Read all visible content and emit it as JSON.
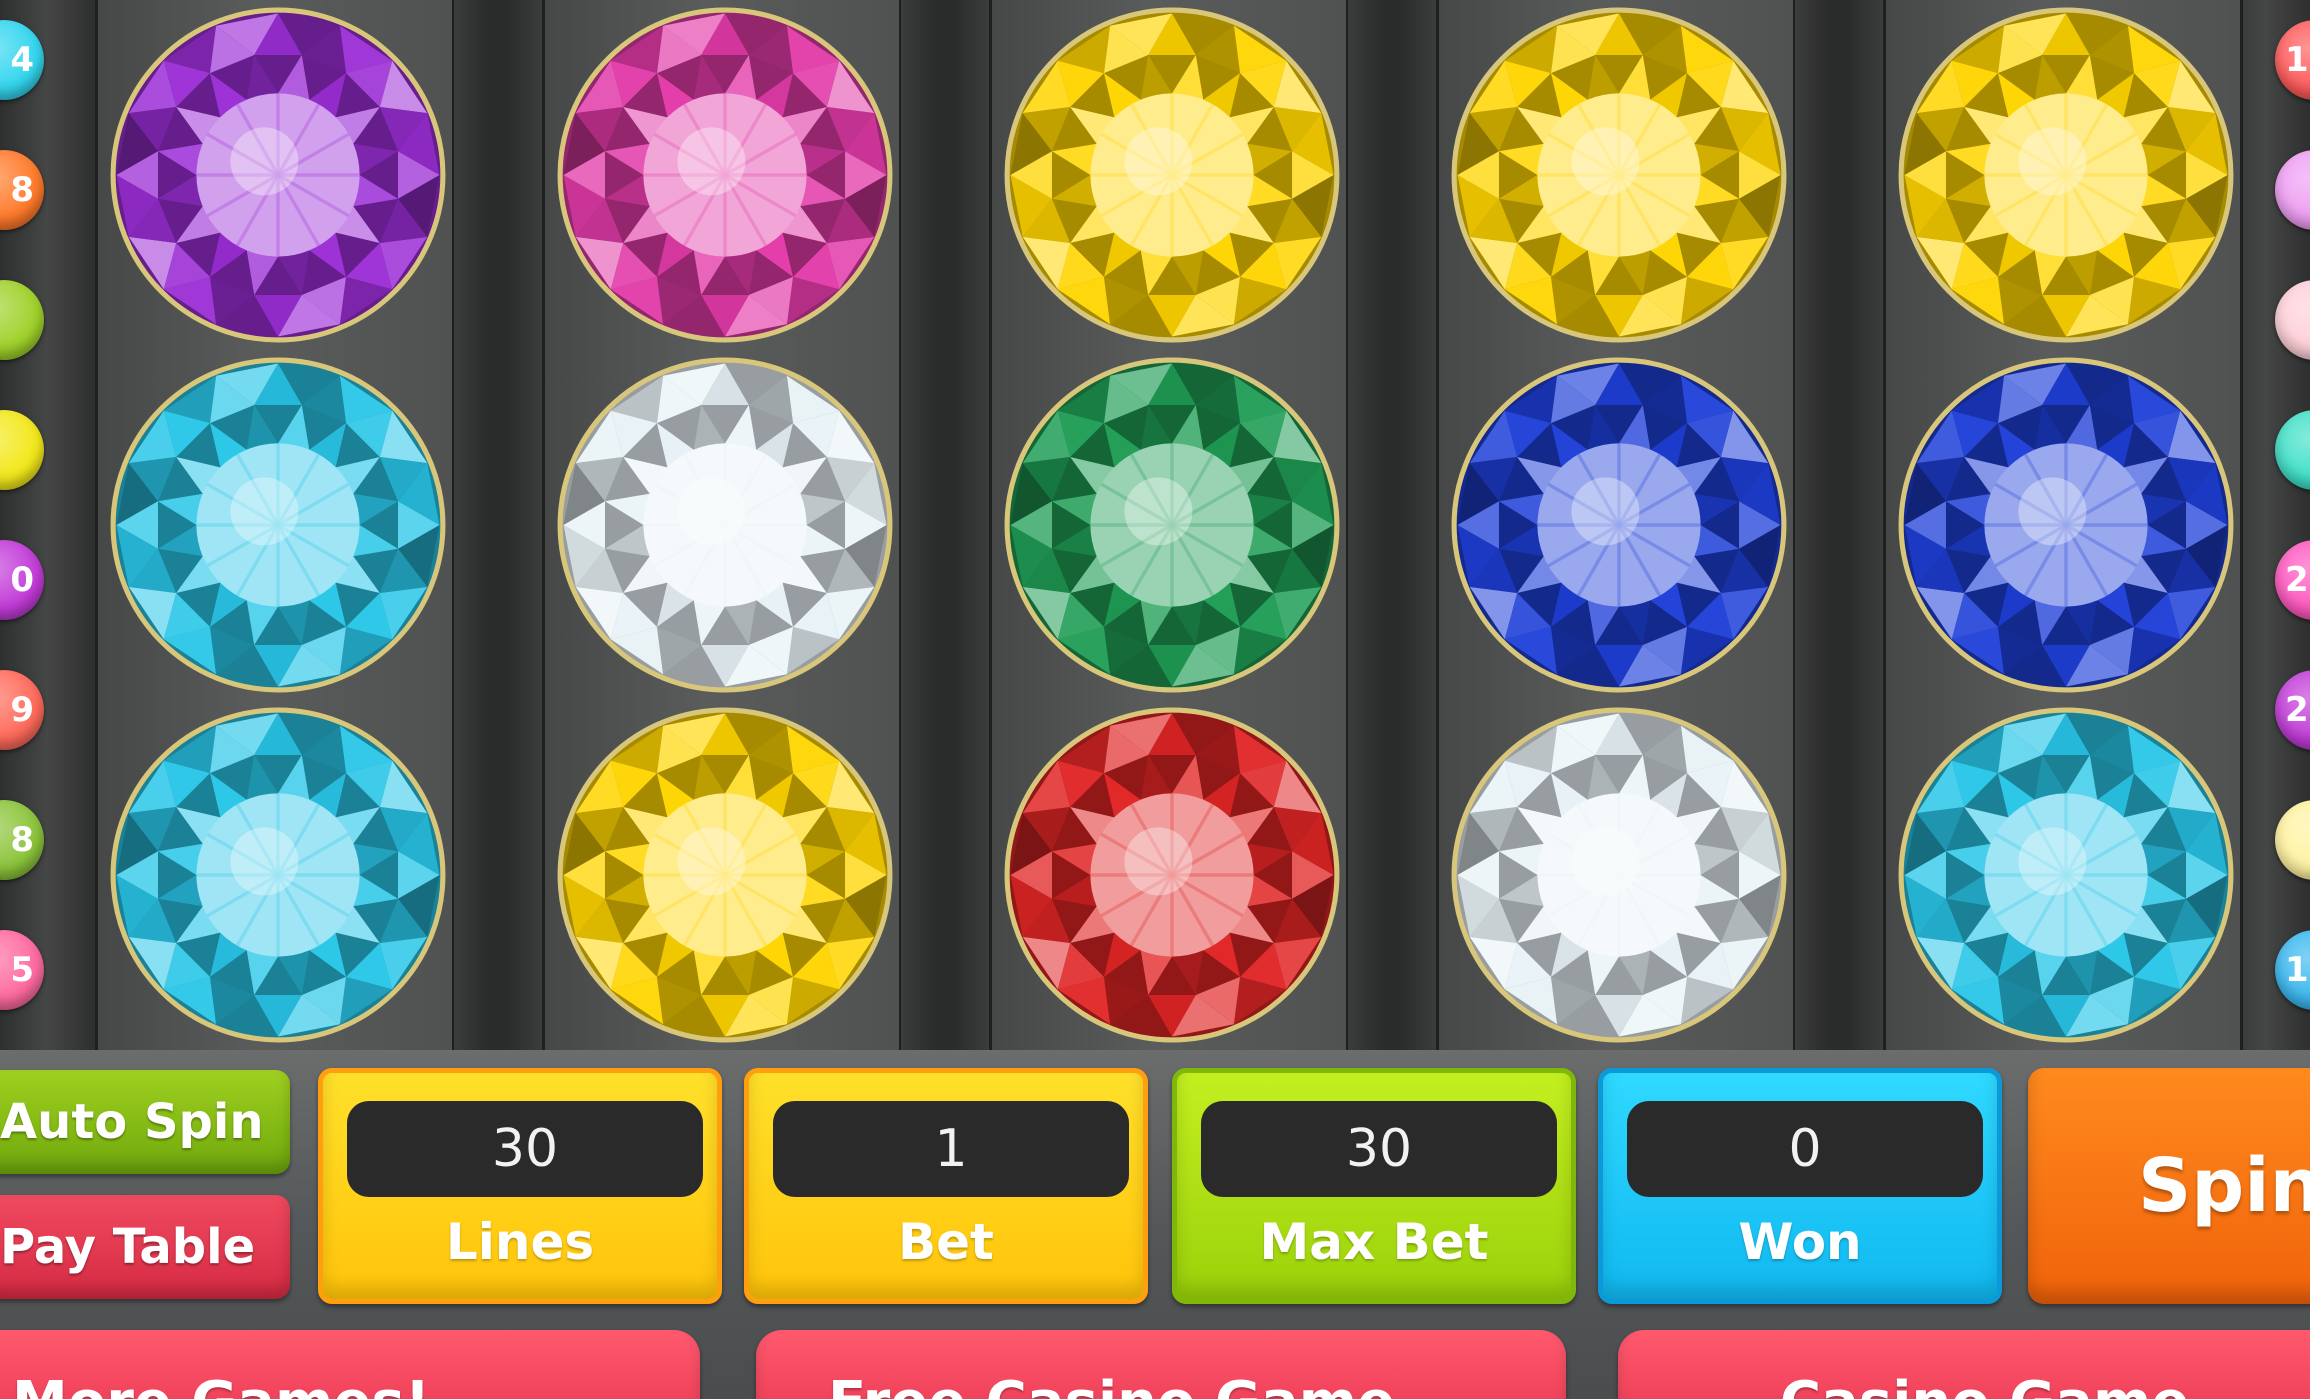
{
  "colors": {
    "purple": "#9b2ed6",
    "pink": "#e23aa8",
    "yellow": "#ffd500",
    "cyan": "#29c6e8",
    "white": "#e8f2f6",
    "green": "#1f9d55",
    "blue": "#1e3fd8",
    "red": "#e02525"
  },
  "reels": [
    {
      "symbols": [
        "purple-gem",
        "cyan-gem",
        "cyan-gem"
      ]
    },
    {
      "symbols": [
        "pink-gem",
        "white-gem",
        "yellow-gem"
      ]
    },
    {
      "symbols": [
        "yellow-gem",
        "green-gem",
        "red-gem"
      ]
    },
    {
      "symbols": [
        "yellow-gem",
        "blue-gem",
        "white-gem"
      ]
    },
    {
      "symbols": [
        "yellow-gem",
        "blue-gem",
        "cyan-gem"
      ]
    }
  ],
  "line_markers_left": [
    {
      "label": "4",
      "color": "#33d6ef"
    },
    {
      "label": "8",
      "color": "#ff7a2a"
    },
    {
      "label": "",
      "color": "#9fd12a"
    },
    {
      "label": "",
      "color": "#f2e81a"
    },
    {
      "label": "0",
      "color": "#c23bd8"
    },
    {
      "label": "9",
      "color": "#ff6a5a"
    },
    {
      "label": "8",
      "color": "#8bc43a"
    },
    {
      "label": "5",
      "color": "#ff6aa0"
    }
  ],
  "line_markers_right": [
    {
      "label": "1",
      "color": "#ff5a5a"
    },
    {
      "label": "",
      "color": "#ee9ef2"
    },
    {
      "label": "",
      "color": "#ffd0d8"
    },
    {
      "label": "",
      "color": "#3fe0c8"
    },
    {
      "label": "2",
      "color": "#ff58c0"
    },
    {
      "label": "2",
      "color": "#c23bd8"
    },
    {
      "label": "",
      "color": "#fff3a0"
    },
    {
      "label": "1",
      "color": "#3ab8f0"
    }
  ],
  "controls": {
    "auto_spin_label": "Auto Spin",
    "pay_table_label": "Pay Table",
    "lines": {
      "value": "30",
      "label": "Lines"
    },
    "bet": {
      "value": "1",
      "label": "Bet"
    },
    "max_bet": {
      "value": "30",
      "label": "Max Bet"
    },
    "won": {
      "value": "0",
      "label": "Won"
    },
    "spin_label": "Spin!"
  },
  "bottom_buttons": {
    "more_games": "More Games!",
    "free_casino": "Free Casino Game",
    "casino_game": "Casino Game"
  }
}
